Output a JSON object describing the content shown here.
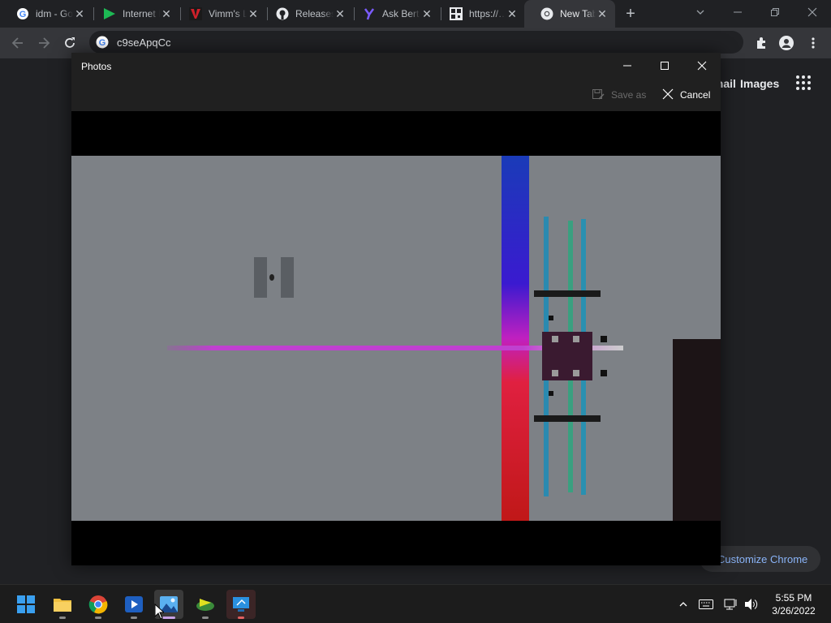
{
  "browser": {
    "tabs": [
      {
        "title": "idm - Google",
        "icon": "google-icon"
      },
      {
        "title": "Internet Download",
        "icon": "idm-arrow-icon"
      },
      {
        "title": "Vimm's Lair",
        "icon": "vimm-icon"
      },
      {
        "title": "Releases",
        "icon": "github-icon"
      },
      {
        "title": "Ask Bert",
        "icon": "yahoo-icon"
      },
      {
        "title": "https://…",
        "icon": "qr-icon"
      },
      {
        "title": "New Tab",
        "icon": "chrome-icon",
        "active": true
      }
    ],
    "address": "c9seApqCc"
  },
  "page": {
    "gmail": "Gmail",
    "images": "Images",
    "customize": "Customize Chrome"
  },
  "photos": {
    "title": "Photos",
    "save_as": "Save as",
    "cancel": "Cancel"
  },
  "taskbar": {
    "time": "5:55 PM",
    "date": "3/26/2022"
  },
  "colors": {
    "accent_blue": "#8ab4f8",
    "photos_bg": "#202020",
    "image_gray": "#7d8186"
  }
}
